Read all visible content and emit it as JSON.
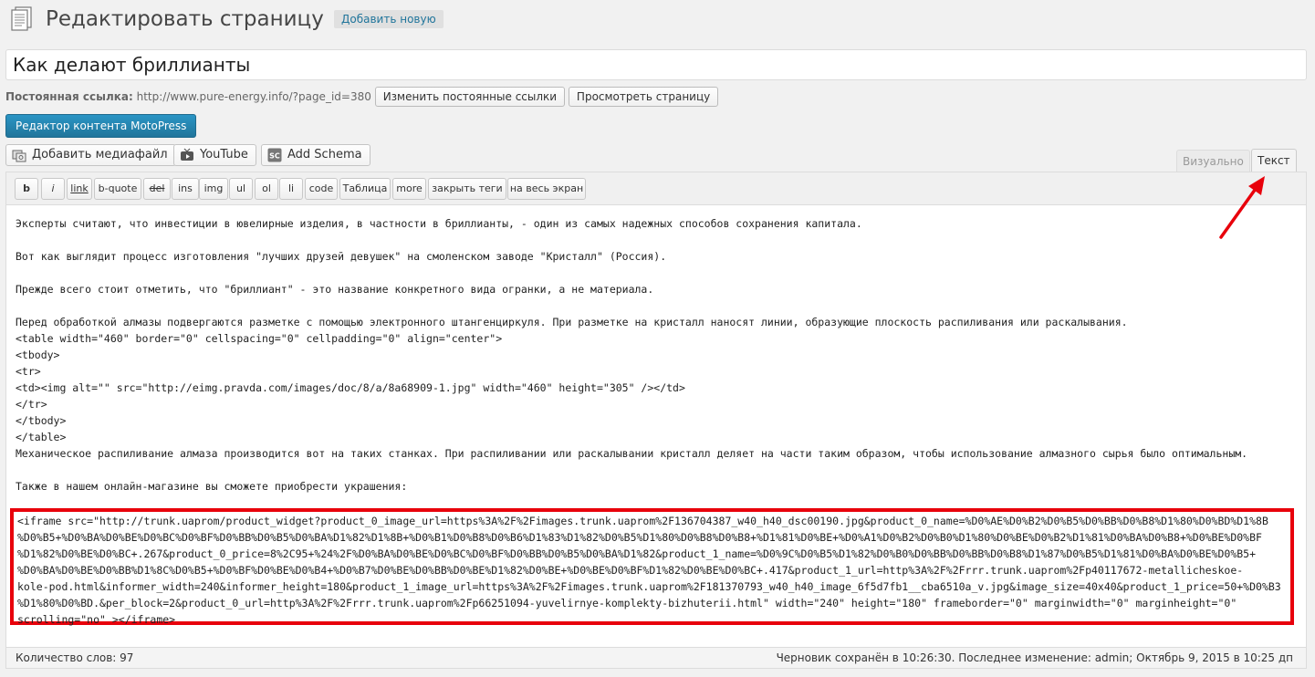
{
  "header": {
    "title": "Редактировать страницу",
    "add_new": "Добавить новую"
  },
  "post": {
    "title": "Как делают бриллианты"
  },
  "permalink": {
    "label": "Постоянная ссылка:",
    "url": "http://www.pure-energy.info/?page_id=380",
    "change_button": "Изменить постоянные ссылки",
    "view_button": "Просмотреть страницу"
  },
  "motopress": {
    "label": "Редактор контента MotoPress"
  },
  "media_buttons": {
    "add_media": "Добавить медиафайл",
    "youtube": "YouTube",
    "schema": "Add Schema"
  },
  "tabs": {
    "visual": "Визуально",
    "text": "Текст"
  },
  "quicktags": [
    "b",
    "i",
    "link",
    "b-quote",
    "del",
    "ins",
    "img",
    "ul",
    "ol",
    "li",
    "code",
    "Таблица",
    "more",
    "закрыть теги",
    "на весь экран"
  ],
  "content_lines": [
    "Эксперты считают, что инвестиции в ювелирные изделия, в частности в бриллианты, - один из самых надежных способов сохранения капитала.",
    "",
    "Вот как выглядит процесс изготовления \"лучших друзей девушек\" на смоленском заводе \"Кристалл\" (Россия).",
    "",
    "Прежде всего стоит отметить, что \"бриллиант\" - это название конкретного вида огранки, а не материала.",
    "",
    "Перед обработкой алмазы подвергаются разметке с помощью электронного штангенциркуля. При разметке на кристалл наносят линии, образующие плоскость распиливания или раскалывания.",
    "<table width=\"460\" border=\"0\" cellspacing=\"0\" cellpadding=\"0\" align=\"center\">",
    "<tbody>",
    "<tr>",
    "<td><img alt=\"\" src=\"http://eimg.pravda.com/images/doc/8/a/8a68909-1.jpg\" width=\"460\" height=\"305\" /></td>",
    "</tr>",
    "</tbody>",
    "</table>",
    "Механическое распиливание алмаза производится вот на таких станках. При распиливании или раскалывании кристалл деляет на части таким образом, чтобы использование алмазного сырья было оптимальным.",
    "",
    "Также в нашем онлайн-магазине вы сможете приобрести украшения:"
  ],
  "iframe_lines": [
    "<iframe src=\"http://trunk.uaprom/product_widget?product_0_image_url=https%3A%2F%2Fimages.trunk.uaprom%2F136704387_w40_h40_dsc00190.jpg&product_0_name=%D0%AE%D0%B2%D0%B5%D0%BB%D0%B8%D1%80%D0%BD%D1%8B",
    "%D0%B5+%D0%BA%D0%BE%D0%BC%D0%BF%D0%BB%D0%B5%D0%BA%D1%82%D1%8B+%D0%B1%D0%B8%D0%B6%D1%83%D1%82%D0%B5%D1%80%D0%B8%D0%B8+%D1%81%D0%BE+%D0%A1%D0%B2%D0%B0%D1%80%D0%BE%D0%B2%D1%81%D0%BA%D0%B8+%D0%BE%D0%BF",
    "%D1%82%D0%BE%D0%BC+.267&product_0_price=8%2C95+%24%2F%D0%BA%D0%BE%D0%BC%D0%BF%D0%BB%D0%B5%D0%BA%D1%82&product_1_name=%D0%9C%D0%B5%D1%82%D0%B0%D0%BB%D0%BB%D0%B8%D1%87%D0%B5%D1%81%D0%BA%D0%BE%D0%B5+",
    "%D0%BA%D0%BE%D0%BB%D1%8C%D0%B5+%D0%BF%D0%BE%D0%B4+%D0%B7%D0%BE%D0%BB%D0%BE%D1%82%D0%BE+%D0%BE%D0%BF%D1%82%D0%BE%D0%BC+.417&product_1_url=http%3A%2F%2Frrr.trunk.uaprom%2Fp40117672-metallicheskoe-",
    "kole-pod.html&informer_width=240&informer_height=180&product_1_image_url=https%3A%2F%2Fimages.trunk.uaprom%2F181370793_w40_h40_image_6f5d7fb1__cba6510a_v.jpg&image_size=40x40&product_1_price=50+%D0%B3",
    "%D1%80%D0%BD.&per_block=2&product_0_url=http%3A%2F%2Frrr.trunk.uaprom%2Fp66251094-yuvelirnye-komplekty-bizhuterii.html\" width=\"240\" height=\"180\" frameborder=\"0\" marginwidth=\"0\" marginheight=\"0\"",
    "scrolling=\"no\" ></iframe>"
  ],
  "status": {
    "word_count": "Количество слов: 97",
    "autosave": "Черновик сохранён в 10:26:30. Последнее изменение: admin; Октябрь 9, 2015 в 10:25 дп"
  },
  "colors": {
    "accent": "#21759b",
    "highlight_border": "#e8000b"
  },
  "icons": {
    "page": "page-icon",
    "add_media": "camera-icon",
    "youtube": "youtube-icon",
    "schema": "schema-icon",
    "annotation": "red-arrow-icon"
  }
}
